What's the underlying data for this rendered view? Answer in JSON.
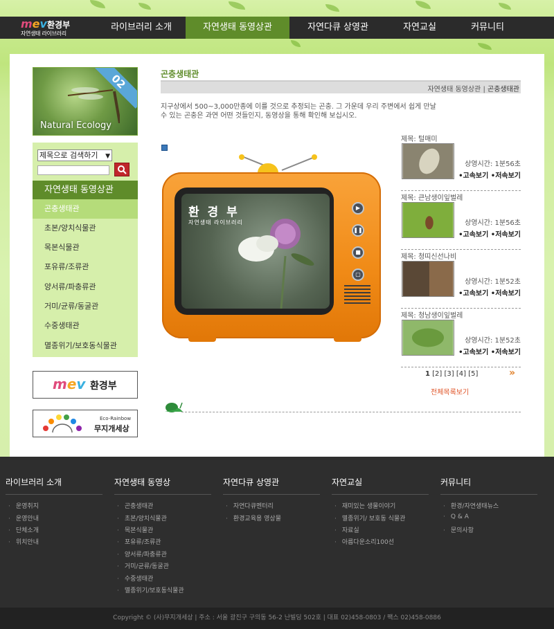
{
  "brand": {
    "logo_text": "환경부",
    "logo_sub": "자연생태 라이브러리"
  },
  "nav": [
    {
      "label": "라이브러리 소개"
    },
    {
      "label": "자연생태 동영상관"
    },
    {
      "label": "자연다큐 상영관"
    },
    {
      "label": "자연교실"
    },
    {
      "label": "커뮤니티"
    }
  ],
  "banner": {
    "number": "02",
    "caption": "Natural Ecology"
  },
  "search": {
    "select_value": "제목으로 검색하기"
  },
  "sidebar": {
    "title": "자연생태 동영상관",
    "items": [
      {
        "label": "곤충생태관"
      },
      {
        "label": "초본/양치식물관"
      },
      {
        "label": "목본식물관"
      },
      {
        "label": "포유류/조류관"
      },
      {
        "label": "양서류/파충류관"
      },
      {
        "label": "거미/균류/동굴관"
      },
      {
        "label": "수중생태관"
      },
      {
        "label": "멸종위기/보호동식물관"
      }
    ]
  },
  "partners": {
    "moe": {
      "label": "환경부"
    },
    "rainbow": {
      "eng": "Eco-Rainbow",
      "label": "무지개세상"
    }
  },
  "main": {
    "title": "곤충생태관",
    "breadcrumb_parent": "자연생태 동영상관",
    "breadcrumb_sep": "|",
    "breadcrumb_current": "곤충생태관",
    "intro": "지구상에서 500~3,000만종에 이를 것으로 추정되는 곤충. 그 가운데 우리 주변에서 쉽게 만날 수 있는 곤충은 과연 어떤 것들인지, 동영상을 통해 확인해 보십시오."
  },
  "tv": {
    "brand": "환 경 부",
    "brand_sub": "자연생태 라이브러리"
  },
  "videos": [
    {
      "title": "제목: 털매미",
      "duration": "상영시간: 1분56초",
      "actions": "•고속보기 •저속보기"
    },
    {
      "title": "제목: 큰남생이잎벌레",
      "duration": "상영시간: 1분56초",
      "actions": "•고속보기 •저속보기"
    },
    {
      "title": "제목: 청띠신선나비",
      "duration": "상영시간: 1분52초",
      "actions": "•고속보기 •저속보기"
    },
    {
      "title": "제목: 청남생이잎벌레",
      "duration": "상영시간: 1분52초",
      "actions": "•고속보기 •저속보기"
    }
  ],
  "pager": {
    "current": "1",
    "pages": [
      "[2]",
      "[3]",
      "[4]",
      "[5]"
    ],
    "next": "»"
  },
  "view_all": "전체목록보기",
  "footer": {
    "cols": [
      {
        "title": "라이브러리 소개",
        "links": [
          "운영취지",
          "운영안내",
          "단체소개",
          "위치안내"
        ]
      },
      {
        "title": "자연생태 동영상",
        "links": [
          "곤충생태관",
          "초본/양치식물관",
          "목본식물관",
          "포유류/조류관",
          "양서류/파충류관",
          "거미/균류/동굴관",
          "수중생태관",
          "멸종위기/보호동식물관"
        ]
      },
      {
        "title": "자연다큐 상영관",
        "links": [
          "자연다큐멘터리",
          "환경교육용 영상물"
        ]
      },
      {
        "title": "자연교실",
        "links": [
          "재미있는 생물이야기",
          "멸종위기/ 보호동 식물관",
          "자료실",
          "아름다운소리100선"
        ]
      },
      {
        "title": "커뮤니티",
        "links": [
          "환경/자연생태뉴스",
          "Q & A",
          "문의사항"
        ]
      }
    ],
    "copyright": "Copyright © (사)무지개세상   |   주소 : 서울 광진구 구의동 56-2 난빌딩 502호   |   대표 02)458-0803  /  팩스 02)458-0886"
  }
}
